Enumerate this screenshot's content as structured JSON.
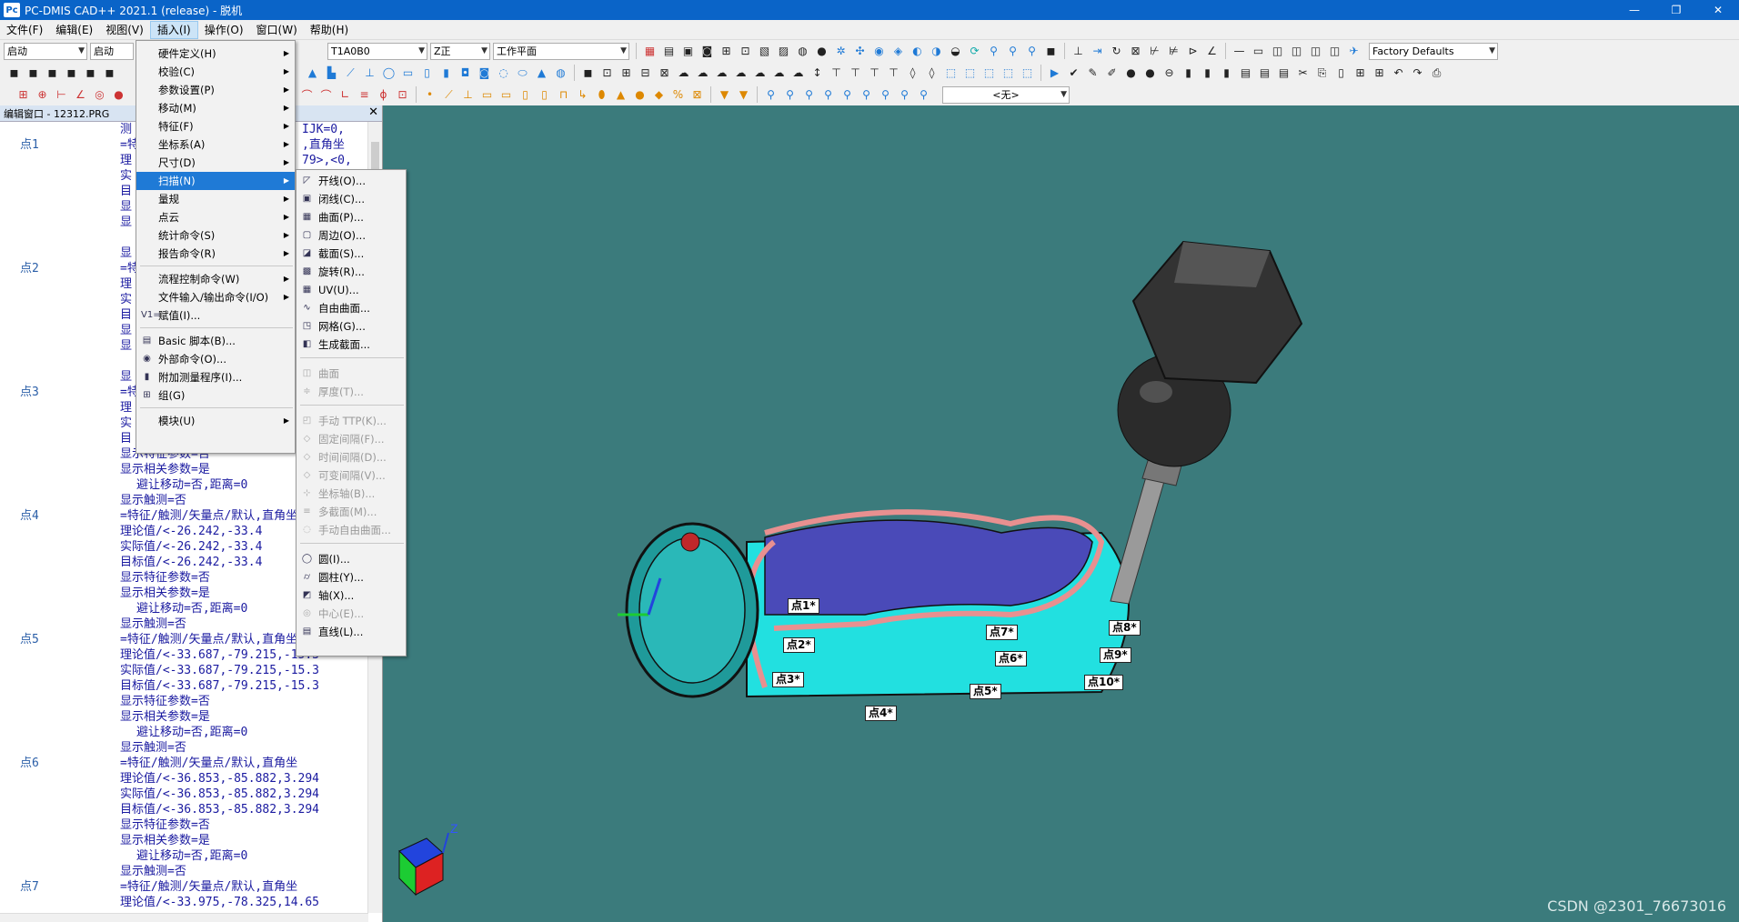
{
  "window": {
    "title": "PC-DMIS CAD++ 2021.1 (release) - 脱机",
    "app_icon": "Pc",
    "min": "—",
    "restore": "❐",
    "close": "✕"
  },
  "menubar": [
    "文件(F)",
    "编辑(E)",
    "视图(V)",
    "插入(I)",
    "操作(O)",
    "窗口(W)",
    "帮助(H)"
  ],
  "toolbar1": {
    "combo1": "启动",
    "combo2": "启动",
    "combo3": "T1A0B0",
    "combo4": "Z正",
    "combo5": "工作平面",
    "combo6": "Factory Defaults"
  },
  "toolbar3": {
    "combo_none": "<无>"
  },
  "edit_window": {
    "title": "编辑窗口 - 12312.PRG",
    "lines": [
      {
        "name": "",
        "text": "测",
        "extra": "IJK=0,"
      },
      {
        "name": "点1",
        "text": "=特",
        "extra": ",直角坐"
      },
      {
        "name": "",
        "text": "理",
        "extra": "79>,<0,"
      },
      {
        "name": "",
        "text": "实",
        "extra": ""
      },
      {
        "name": "",
        "text": "目",
        "extra": ""
      },
      {
        "name": "",
        "text": "显",
        "extra": ""
      },
      {
        "name": "",
        "text": "显",
        "extra": ""
      },
      {
        "name": "",
        "text": "",
        "extra": ""
      },
      {
        "name": "",
        "text": "显",
        "extra": ""
      },
      {
        "name": "点2",
        "text": "=特",
        "extra": ""
      },
      {
        "name": "",
        "text": "理",
        "extra": ""
      },
      {
        "name": "",
        "text": "实",
        "extra": ""
      },
      {
        "name": "",
        "text": "目",
        "extra": ""
      },
      {
        "name": "",
        "text": "显",
        "extra": ""
      },
      {
        "name": "",
        "text": "显",
        "extra": ""
      },
      {
        "name": "",
        "text": "",
        "extra": ""
      },
      {
        "name": "",
        "text": "显",
        "extra": ""
      },
      {
        "name": "点3",
        "text": "=特",
        "extra": ""
      },
      {
        "name": "",
        "text": "理",
        "extra": ""
      },
      {
        "name": "",
        "text": "实",
        "extra": ""
      },
      {
        "name": "",
        "text": "目",
        "extra": ""
      },
      {
        "name": "",
        "text": "显示特征参数=否",
        "extra": ""
      },
      {
        "name": "",
        "text": "显示相关参数=是",
        "extra": ""
      },
      {
        "name": "",
        "text": "避让移动=否,距离=0",
        "extra": "",
        "indent": true
      },
      {
        "name": "",
        "text": "显示触测=否",
        "extra": ""
      },
      {
        "name": "点4",
        "text": "=特征/触测/矢量点/默认,直角坐",
        "extra": ""
      },
      {
        "name": "",
        "text": "理论值/<-26.242,-33.4",
        "extra": ""
      },
      {
        "name": "",
        "text": "实际值/<-26.242,-33.4",
        "extra": ""
      },
      {
        "name": "",
        "text": "目标值/<-26.242,-33.4",
        "extra": ""
      },
      {
        "name": "",
        "text": "显示特征参数=否",
        "extra": ""
      },
      {
        "name": "",
        "text": "显示相关参数=是",
        "extra": ""
      },
      {
        "name": "",
        "text": "避让移动=否,距离=0",
        "extra": "",
        "indent": true
      },
      {
        "name": "",
        "text": "显示触测=否",
        "extra": ""
      },
      {
        "name": "点5",
        "text": "=特征/触测/矢量点/默认,直角坐",
        "extra": ""
      },
      {
        "name": "",
        "text": "理论值/<-33.687,-79.215,-15.3",
        "extra": ""
      },
      {
        "name": "",
        "text": "实际值/<-33.687,-79.215,-15.3",
        "extra": ""
      },
      {
        "name": "",
        "text": "目标值/<-33.687,-79.215,-15.3",
        "extra": ""
      },
      {
        "name": "",
        "text": "显示特征参数=否",
        "extra": ""
      },
      {
        "name": "",
        "text": "显示相关参数=是",
        "extra": ""
      },
      {
        "name": "",
        "text": "避让移动=否,距离=0",
        "extra": "",
        "indent": true
      },
      {
        "name": "",
        "text": "显示触测=否",
        "extra": ""
      },
      {
        "name": "点6",
        "text": "=特征/触测/矢量点/默认,直角坐",
        "extra": ""
      },
      {
        "name": "",
        "text": "理论值/<-36.853,-85.882,3.294",
        "extra": ""
      },
      {
        "name": "",
        "text": "实际值/<-36.853,-85.882,3.294",
        "extra": ""
      },
      {
        "name": "",
        "text": "目标值/<-36.853,-85.882,3.294",
        "extra": ""
      },
      {
        "name": "",
        "text": "显示特征参数=否",
        "extra": ""
      },
      {
        "name": "",
        "text": "显示相关参数=是",
        "extra": ""
      },
      {
        "name": "",
        "text": "避让移动=否,距离=0",
        "extra": "",
        "indent": true
      },
      {
        "name": "",
        "text": "显示触测=否",
        "extra": ""
      },
      {
        "name": "点7",
        "text": "=特征/触测/矢量点/默认,直角坐",
        "extra": ""
      },
      {
        "name": "",
        "text": "理论值/<-33.975,-78.325,14.65",
        "extra": ""
      }
    ]
  },
  "insert_menu": {
    "items": [
      {
        "label": "硬件定义(H)",
        "sub": true
      },
      {
        "label": "校验(C)",
        "sub": true
      },
      {
        "label": "参数设置(P)",
        "sub": true
      },
      {
        "label": "移动(M)",
        "sub": true
      },
      {
        "label": "特征(F)",
        "sub": true
      },
      {
        "label": "坐标系(A)",
        "sub": true
      },
      {
        "label": "尺寸(D)",
        "sub": true
      },
      {
        "label": "扫描(N)",
        "sub": true,
        "highlight": true
      },
      {
        "label": "量规",
        "sub": true
      },
      {
        "label": "点云",
        "sub": true
      },
      {
        "label": "统计命令(S)",
        "sub": true
      },
      {
        "label": "报告命令(R)",
        "sub": true
      },
      {
        "label": "流程控制命令(W)",
        "sub": true
      },
      {
        "label": "文件输入/输出命令(I/O)",
        "sub": true
      },
      {
        "label": "赋值(I)...",
        "sub": false,
        "icon": "V1="
      },
      {
        "label": "Basic 脚本(B)...",
        "sub": false,
        "icon": "▤"
      },
      {
        "label": "外部命令(O)...",
        "sub": false,
        "icon": "◉"
      },
      {
        "label": "附加测量程序(I)...",
        "sub": false,
        "icon": "▮"
      },
      {
        "label": "组(G)",
        "sub": false,
        "icon": "⊞"
      },
      {
        "label": "模块(U)",
        "sub": true
      }
    ]
  },
  "scan_menu": {
    "items": [
      {
        "label": "开线(O)...",
        "icon": "◸"
      },
      {
        "label": "闭线(C)...",
        "icon": "▣"
      },
      {
        "label": "曲面(P)...",
        "icon": "▦"
      },
      {
        "label": "周边(O)...",
        "icon": "▢"
      },
      {
        "label": "截面(S)...",
        "icon": "◪"
      },
      {
        "label": "旋转(R)...",
        "icon": "▩"
      },
      {
        "label": "UV(U)...",
        "icon": "▦"
      },
      {
        "label": "自由曲面...",
        "icon": "∿"
      },
      {
        "label": "网格(G)...",
        "icon": "◳"
      },
      {
        "label": "生成截面...",
        "icon": "◧"
      },
      {
        "label": "曲面",
        "icon": "◫",
        "disabled": true
      },
      {
        "label": "厚度(T)...",
        "icon": "≑",
        "disabled": true
      },
      {
        "label": "手动 TTP(K)...",
        "icon": "◰",
        "disabled": true
      },
      {
        "label": "固定间隔(F)...",
        "icon": "◇",
        "disabled": true
      },
      {
        "label": "时间间隔(D)...",
        "icon": "◇",
        "disabled": true
      },
      {
        "label": "可变间隔(V)...",
        "icon": "◇",
        "disabled": true
      },
      {
        "label": "坐标轴(B)...",
        "icon": "⊹",
        "disabled": true
      },
      {
        "label": "多截面(M)...",
        "icon": "≡",
        "disabled": true
      },
      {
        "label": "手动自由曲面...",
        "icon": "◌",
        "disabled": true
      },
      {
        "label": "圆(I)...",
        "icon": "◯"
      },
      {
        "label": "圆柱(Y)...",
        "icon": "⌭"
      },
      {
        "label": "轴(X)...",
        "icon": "◩"
      },
      {
        "label": "中心(E)...",
        "icon": "◎",
        "disabled": true
      },
      {
        "label": "直线(L)...",
        "icon": "▤"
      }
    ]
  },
  "viewport": {
    "points": [
      "点1*",
      "点2*",
      "点3*",
      "点4*",
      "点5*",
      "点6*",
      "点7*",
      "点8*",
      "点9*",
      "点10*"
    ],
    "axis_label": "Z",
    "watermark": "CSDN @2301_76673016"
  },
  "colors": {
    "titlebar": "#0a64c8",
    "viewport_bg": "#3b7b7c",
    "highlight": "#1f7ad6",
    "part_cyan": "#22e0e0",
    "part_purple": "#4a4ab8",
    "part_pink": "#e89090"
  }
}
